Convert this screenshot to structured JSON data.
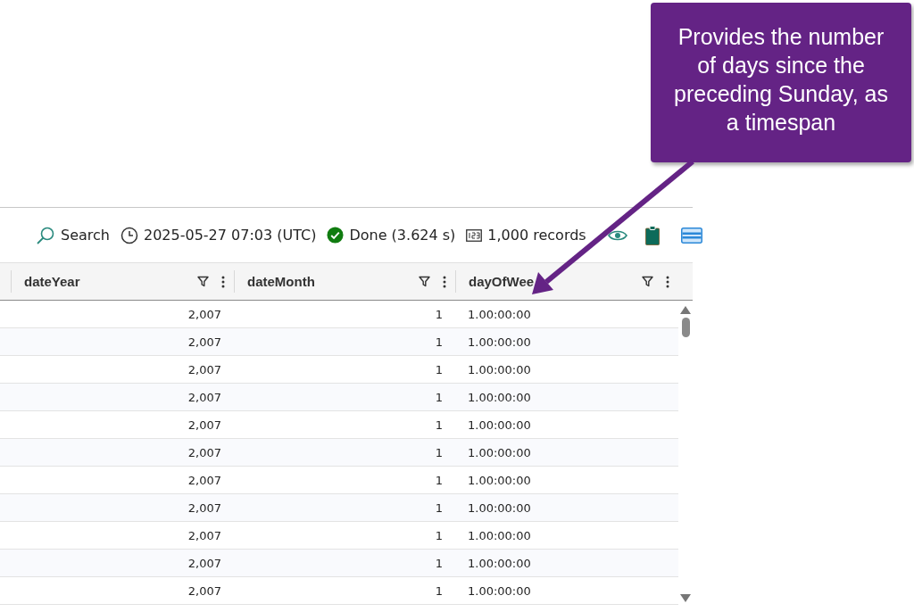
{
  "toolbar": {
    "search": "Search",
    "timestamp": "2025-05-27 07:03 (UTC)",
    "status": "Done (3.624 s)",
    "records": "1,000 records"
  },
  "table": {
    "columns": [
      "dateYear",
      "dateMonth",
      "dayOfWee"
    ],
    "rows": [
      [
        "2,007",
        "1",
        "1.00:00:00"
      ],
      [
        "2,007",
        "1",
        "1.00:00:00"
      ],
      [
        "2,007",
        "1",
        "1.00:00:00"
      ],
      [
        "2,007",
        "1",
        "1.00:00:00"
      ],
      [
        "2,007",
        "1",
        "1.00:00:00"
      ],
      [
        "2,007",
        "1",
        "1.00:00:00"
      ],
      [
        "2,007",
        "1",
        "1.00:00:00"
      ],
      [
        "2,007",
        "1",
        "1.00:00:00"
      ],
      [
        "2,007",
        "1",
        "1.00:00:00"
      ],
      [
        "2,007",
        "1",
        "1.00:00:00"
      ],
      [
        "2,007",
        "1",
        "1.00:00:00"
      ]
    ]
  },
  "callout": {
    "text": "Provides the number of days since the preceding Sunday, as a timespan"
  }
}
